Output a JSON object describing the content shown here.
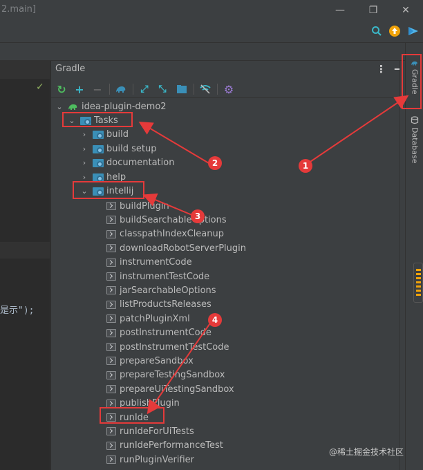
{
  "window": {
    "title": "2.main]",
    "minimize_glyph": "—",
    "restore_glyph": "❐",
    "close_glyph": "✕"
  },
  "editor": {
    "code_fragment": "是示\");"
  },
  "gradle_panel": {
    "title": "Gradle",
    "menu_glyph": "⋮",
    "minimize_glyph": "—",
    "tree": {
      "root": "idea-plugin-demo2",
      "tasks_folder": "Tasks",
      "task_groups": [
        "build",
        "build setup",
        "documentation",
        "help"
      ],
      "expanded_group": "intellij",
      "tasks": [
        "buildPlugin",
        "buildSearchableOptions",
        "classpathIndexCleanup",
        "downloadRobotServerPlugin",
        "instrumentCode",
        "instrumentTestCode",
        "jarSearchableOptions",
        "listProductsReleases",
        "patchPluginXml",
        "postInstrumentCode",
        "postInstrumentTestCode",
        "prepareSandbox",
        "prepareTestingSandbox",
        "prepareUiTestingSandbox",
        "publishPlugin",
        "runIde",
        "runIdeForUiTests",
        "runIdePerformanceTest",
        "runPluginVerifier"
      ]
    }
  },
  "right_strip": {
    "tabs": [
      "Gradle",
      "Database"
    ]
  },
  "annotations": {
    "badges": [
      "1",
      "2",
      "3",
      "4"
    ],
    "color": "#e53a3a"
  },
  "watermark": "@稀土掘金技术社区",
  "colors": {
    "panel_bg": "#3c3f41",
    "editor_bg": "#2b2b2b",
    "text": "#bbbbbb",
    "folder_blue": "#3a8fb7",
    "refresh_green": "#4ebd5f",
    "add_cyan": "#3ab7c8",
    "update_orange": "#f0a30a"
  }
}
